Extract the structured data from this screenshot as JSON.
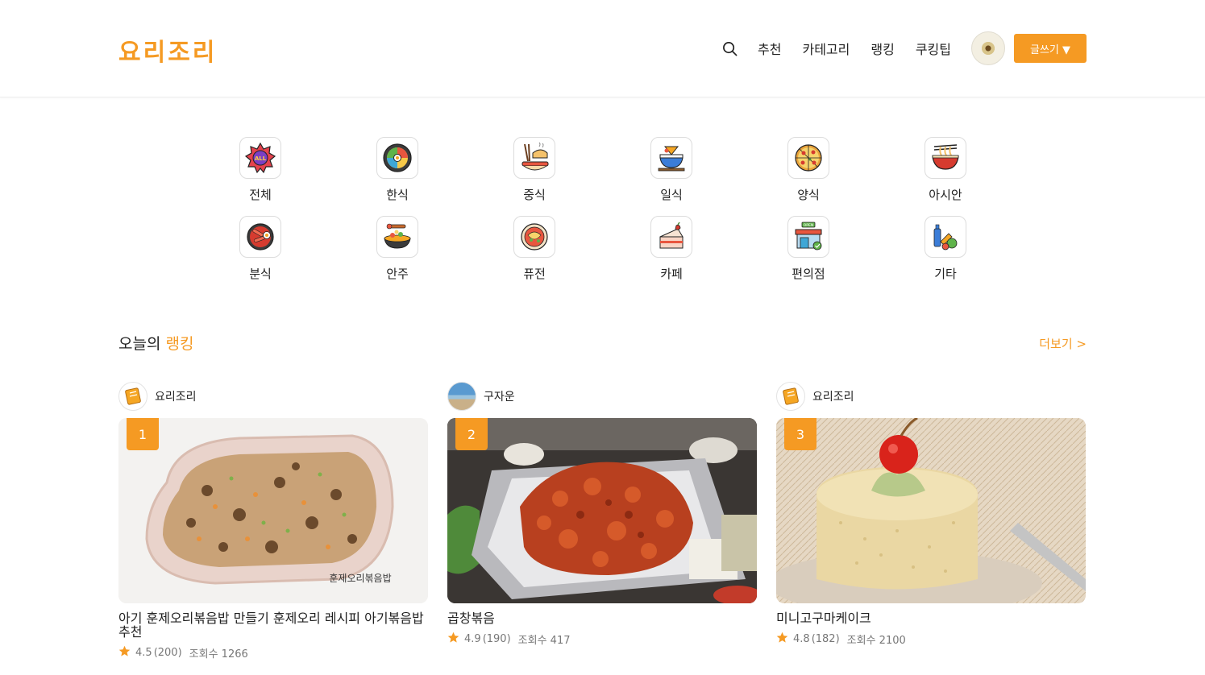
{
  "header": {
    "logo": "요리조리",
    "nav": [
      "추천",
      "카테고리",
      "랭킹",
      "쿠킹팁"
    ],
    "write_label": "글쓰기 ▼"
  },
  "categories": [
    {
      "label": "전체",
      "icon": "all-badge-icon"
    },
    {
      "label": "한식",
      "icon": "bibimbap-icon"
    },
    {
      "label": "중식",
      "icon": "chopsticks-noodle-icon"
    },
    {
      "label": "일식",
      "icon": "tempura-bowl-icon"
    },
    {
      "label": "양식",
      "icon": "pizza-icon"
    },
    {
      "label": "아시안",
      "icon": "noodle-bowl-icon"
    },
    {
      "label": "분식",
      "icon": "tteokbokki-icon"
    },
    {
      "label": "안주",
      "icon": "snack-plate-icon"
    },
    {
      "label": "퓨전",
      "icon": "fusion-dish-icon"
    },
    {
      "label": "카페",
      "icon": "cake-icon"
    },
    {
      "label": "편의점",
      "icon": "convenience-store-icon"
    },
    {
      "label": "기타",
      "icon": "groceries-icon"
    }
  ],
  "ranking": {
    "title_prefix": "오늘의",
    "title_highlight": "랭킹",
    "more_label": "더보기 >",
    "items": [
      {
        "rank": "1",
        "author": "요리조리",
        "title": "아기 훈제오리볶음밥 만들기 훈제오리 레시피 아기볶음밥 추천",
        "rating": "4.5",
        "count": "(200)",
        "views": "조회수 1266",
        "caption": "훈제오리볶음밥"
      },
      {
        "rank": "2",
        "author": "구자운",
        "title": "곱창볶음",
        "rating": "4.9",
        "count": "(190)",
        "views": "조회수 417"
      },
      {
        "rank": "3",
        "author": "요리조리",
        "title": "미니고구마케이크",
        "rating": "4.8",
        "count": "(182)",
        "views": "조회수 2100"
      }
    ]
  },
  "colors": {
    "accent": "#f59a23"
  }
}
